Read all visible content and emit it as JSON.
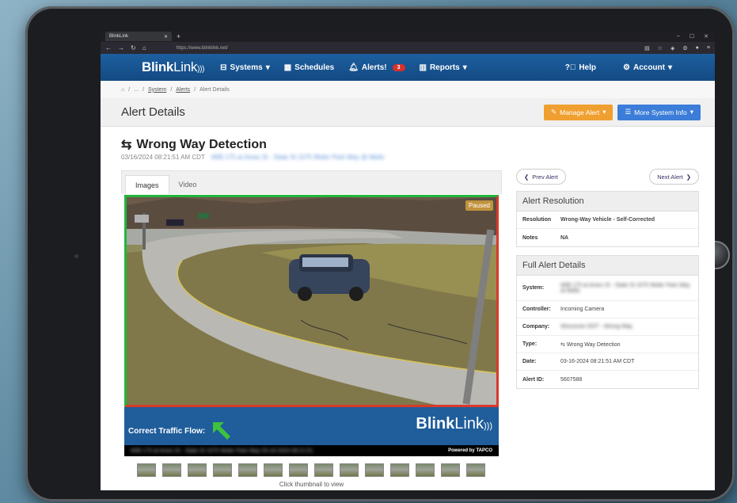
{
  "browser": {
    "tab_title": "BlinkLink",
    "url": "https://www.blinklink.net/"
  },
  "nav": {
    "brand_bold": "Blink",
    "brand_light": "Link",
    "items": [
      {
        "icon": "systems-icon",
        "label": "Systems"
      },
      {
        "icon": "calendar-icon",
        "label": "Schedules"
      },
      {
        "icon": "bell-icon",
        "label": "Alerts!",
        "badge": "3"
      },
      {
        "icon": "chart-icon",
        "label": "Reports"
      }
    ],
    "help": "Help",
    "account": "Account"
  },
  "breadcrumb": {
    "ellipsis": "...",
    "system": "System",
    "alerts": "Alerts",
    "current": "Alert Details"
  },
  "page": {
    "title": "Alert Details",
    "manage_btn": "Manage Alert",
    "more_btn": "More System Info"
  },
  "alert": {
    "title": "Wrong Way Detection",
    "timestamp": "03/16/2024 08:21:51 AM CDT",
    "location_blurred": "WIB 175 at Ames St - State St 1575 Wider Park Way @ Mello"
  },
  "viewer": {
    "tabs": [
      "Images",
      "Video"
    ],
    "status": "Paused",
    "banner_label": "Correct Traffic Flow:",
    "brand_bold": "Blink",
    "brand_light": "Link",
    "powered": "Powered by TAPCO",
    "caption_blurred": "WIB 175 at Ames St - State St 1575 Wider Park Way 03-16-2024 08:21:51",
    "thumb_hint": "Click thumbnail to view",
    "thumb_count": 14
  },
  "side": {
    "prev": "Prev Alert",
    "next": "Next Alert",
    "resolution_head": "Alert Resolution",
    "resolution_label": "Resolution",
    "resolution_value": "Wrong-Way Vehicle - Self-Corrected",
    "notes_label": "Notes",
    "notes_value": "NA",
    "details_head": "Full Alert Details",
    "system_label": "System:",
    "system_value": "WIB 175 at Ames St - State St 1575 Wider Park Way at Mello",
    "controller_label": "Controller:",
    "controller_value": "Incoming Camera",
    "company_label": "Company:",
    "company_value": "Wisconsin DOT - Wrong Way",
    "type_label": "Type:",
    "type_value": "Wrong Way Detection",
    "date_label": "Date:",
    "date_value": "03-16-2024 08:21:51 AM CDT",
    "alertid_label": "Alert ID:",
    "alertid_value": "5607588"
  },
  "colors": {
    "nav": "#1d5fa0",
    "orange": "#f0a030",
    "blue": "#3b7dd8",
    "green_frame": "#22b53c",
    "red_frame": "#d93a2a"
  }
}
